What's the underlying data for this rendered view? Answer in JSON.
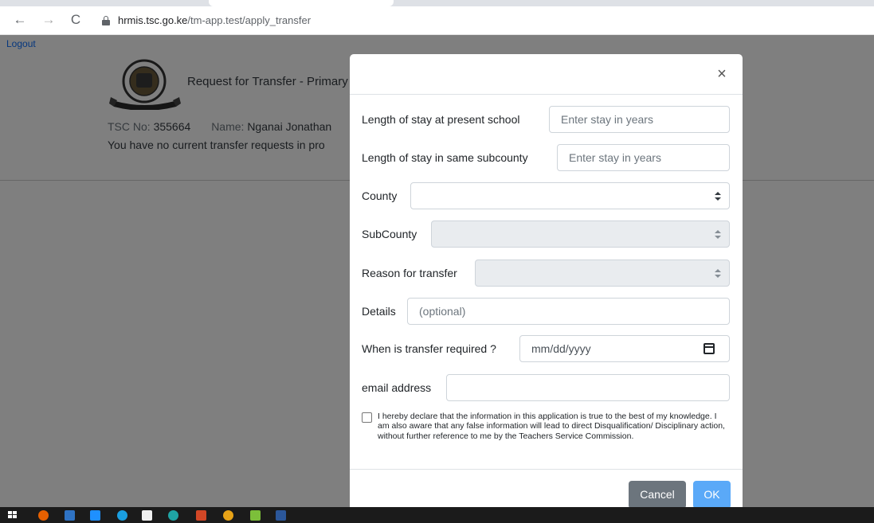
{
  "browser": {
    "url_host": "hrmis.tsc.go.ke",
    "url_path": "/tm-app.test/apply_transfer"
  },
  "page": {
    "logout_label": "Logout",
    "header_title": "Request for Transfer - Primary",
    "tsc_no_label": "TSC No:",
    "tsc_no_value": "355664",
    "name_label": "Name:",
    "name_value": "Nganai Jonathan",
    "no_requests_text": "You have no current transfer requests in pro"
  },
  "modal": {
    "close_glyph": "×",
    "fields": {
      "stay_school_label": "Length of stay at present school",
      "stay_school_placeholder": "Enter stay in years",
      "stay_subcounty_label": "Length of stay in same subcounty",
      "stay_subcounty_placeholder": "Enter stay in years",
      "county_label": "County",
      "county_value": "",
      "subcounty_label": "SubCounty",
      "subcounty_value": "",
      "reason_label": "Reason for transfer",
      "reason_value": "",
      "details_label": "Details",
      "details_placeholder": "(optional)",
      "date_label": "When is transfer required ?",
      "date_placeholder": "mm/dd/yyyy",
      "email_label": "email address",
      "email_value": ""
    },
    "declaration": "I hereby declare that the information in this application is true to the best of my knowledge. I am also aware that any false information will lead to direct Disqualification/ Disciplinary action, without further reference to me by the Teachers Service Commission.",
    "declaration_checked": false,
    "cancel_label": "Cancel",
    "ok_label": "OK"
  },
  "taskbar": {
    "icons": [
      "windows-start-icon",
      "firefox-icon",
      "file-explorer-icon",
      "mail-icon",
      "skype-icon",
      "store-icon",
      "edge-icon",
      "powerpoint-icon",
      "chrome-icon",
      "app-icon",
      "word-icon"
    ]
  }
}
